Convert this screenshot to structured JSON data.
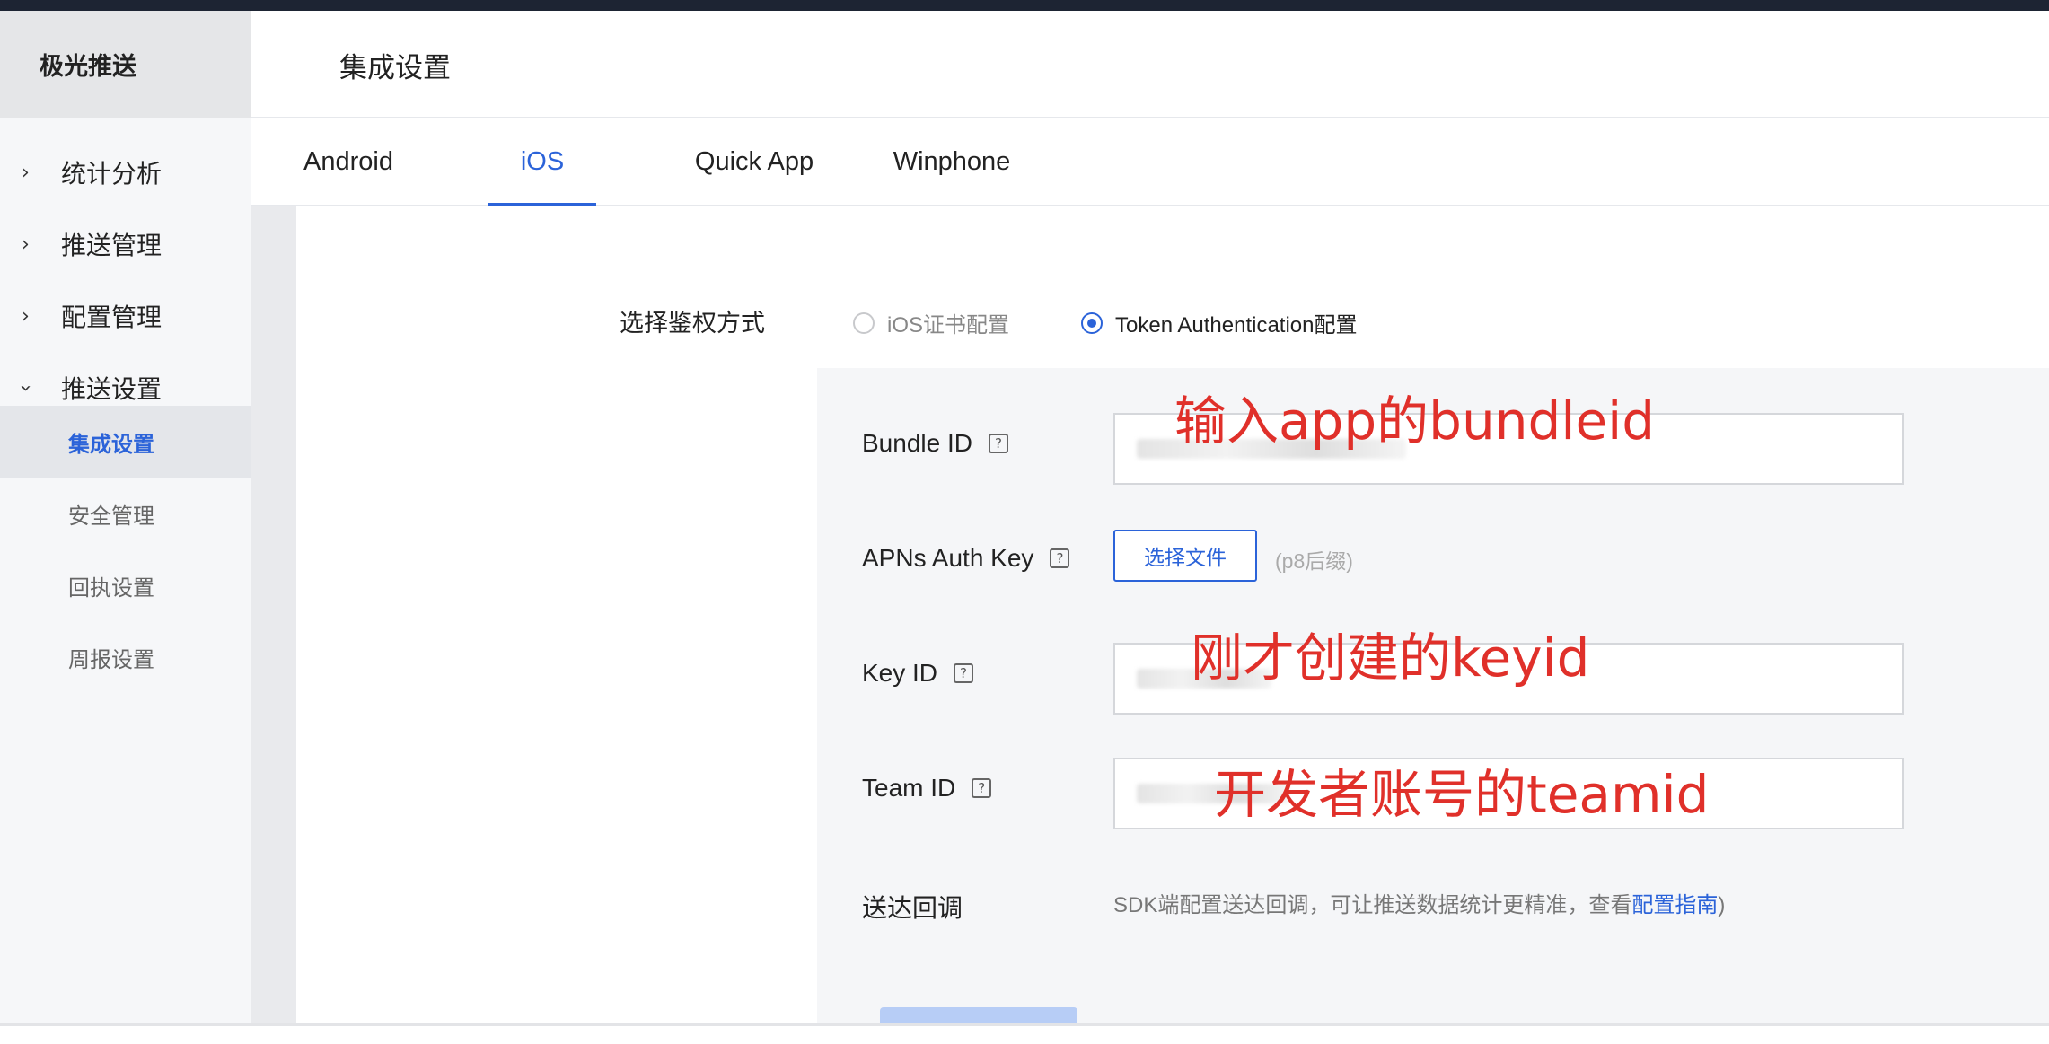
{
  "brand": "极光推送",
  "header_title": "集成设置",
  "sidebar": {
    "groups": [
      {
        "label": "统计分析",
        "expanded": false
      },
      {
        "label": "推送管理",
        "expanded": false
      },
      {
        "label": "配置管理",
        "expanded": false
      },
      {
        "label": "推送设置",
        "expanded": true
      }
    ],
    "sub_items": [
      {
        "label": "集成设置",
        "active": true
      },
      {
        "label": "安全管理",
        "active": false
      },
      {
        "label": "回执设置",
        "active": false
      },
      {
        "label": "周报设置",
        "active": false
      }
    ]
  },
  "tabs": [
    {
      "label": "Android",
      "active": false
    },
    {
      "label": "iOS",
      "active": true
    },
    {
      "label": "Quick App",
      "active": false
    },
    {
      "label": "Winphone",
      "active": false
    }
  ],
  "auth": {
    "label": "选择鉴权方式",
    "options": [
      {
        "label": "iOS证书配置",
        "selected": false
      },
      {
        "label": "Token Authentication配置",
        "selected": true
      }
    ]
  },
  "form": {
    "bundle_id_label": "Bundle ID",
    "apns_key_label": "APNs Auth Key",
    "file_button": "选择文件",
    "file_hint": "(p8后缀)",
    "key_id_label": "Key ID",
    "team_id_label": "Team ID",
    "callback_label": "送达回调",
    "callback_desc_prefix": "SDK端配置送达回调，可让推送数据统计更精准，查看",
    "callback_link": "配置指南",
    "callback_desc_suffix": ")"
  },
  "annotations": {
    "bundle": "输入app的bundleid",
    "keyid": "刚才创建的keyid",
    "teamid": "开发者账号的teamid"
  },
  "colors": {
    "accent": "#2b63d9",
    "annotation": "#e0302a"
  }
}
